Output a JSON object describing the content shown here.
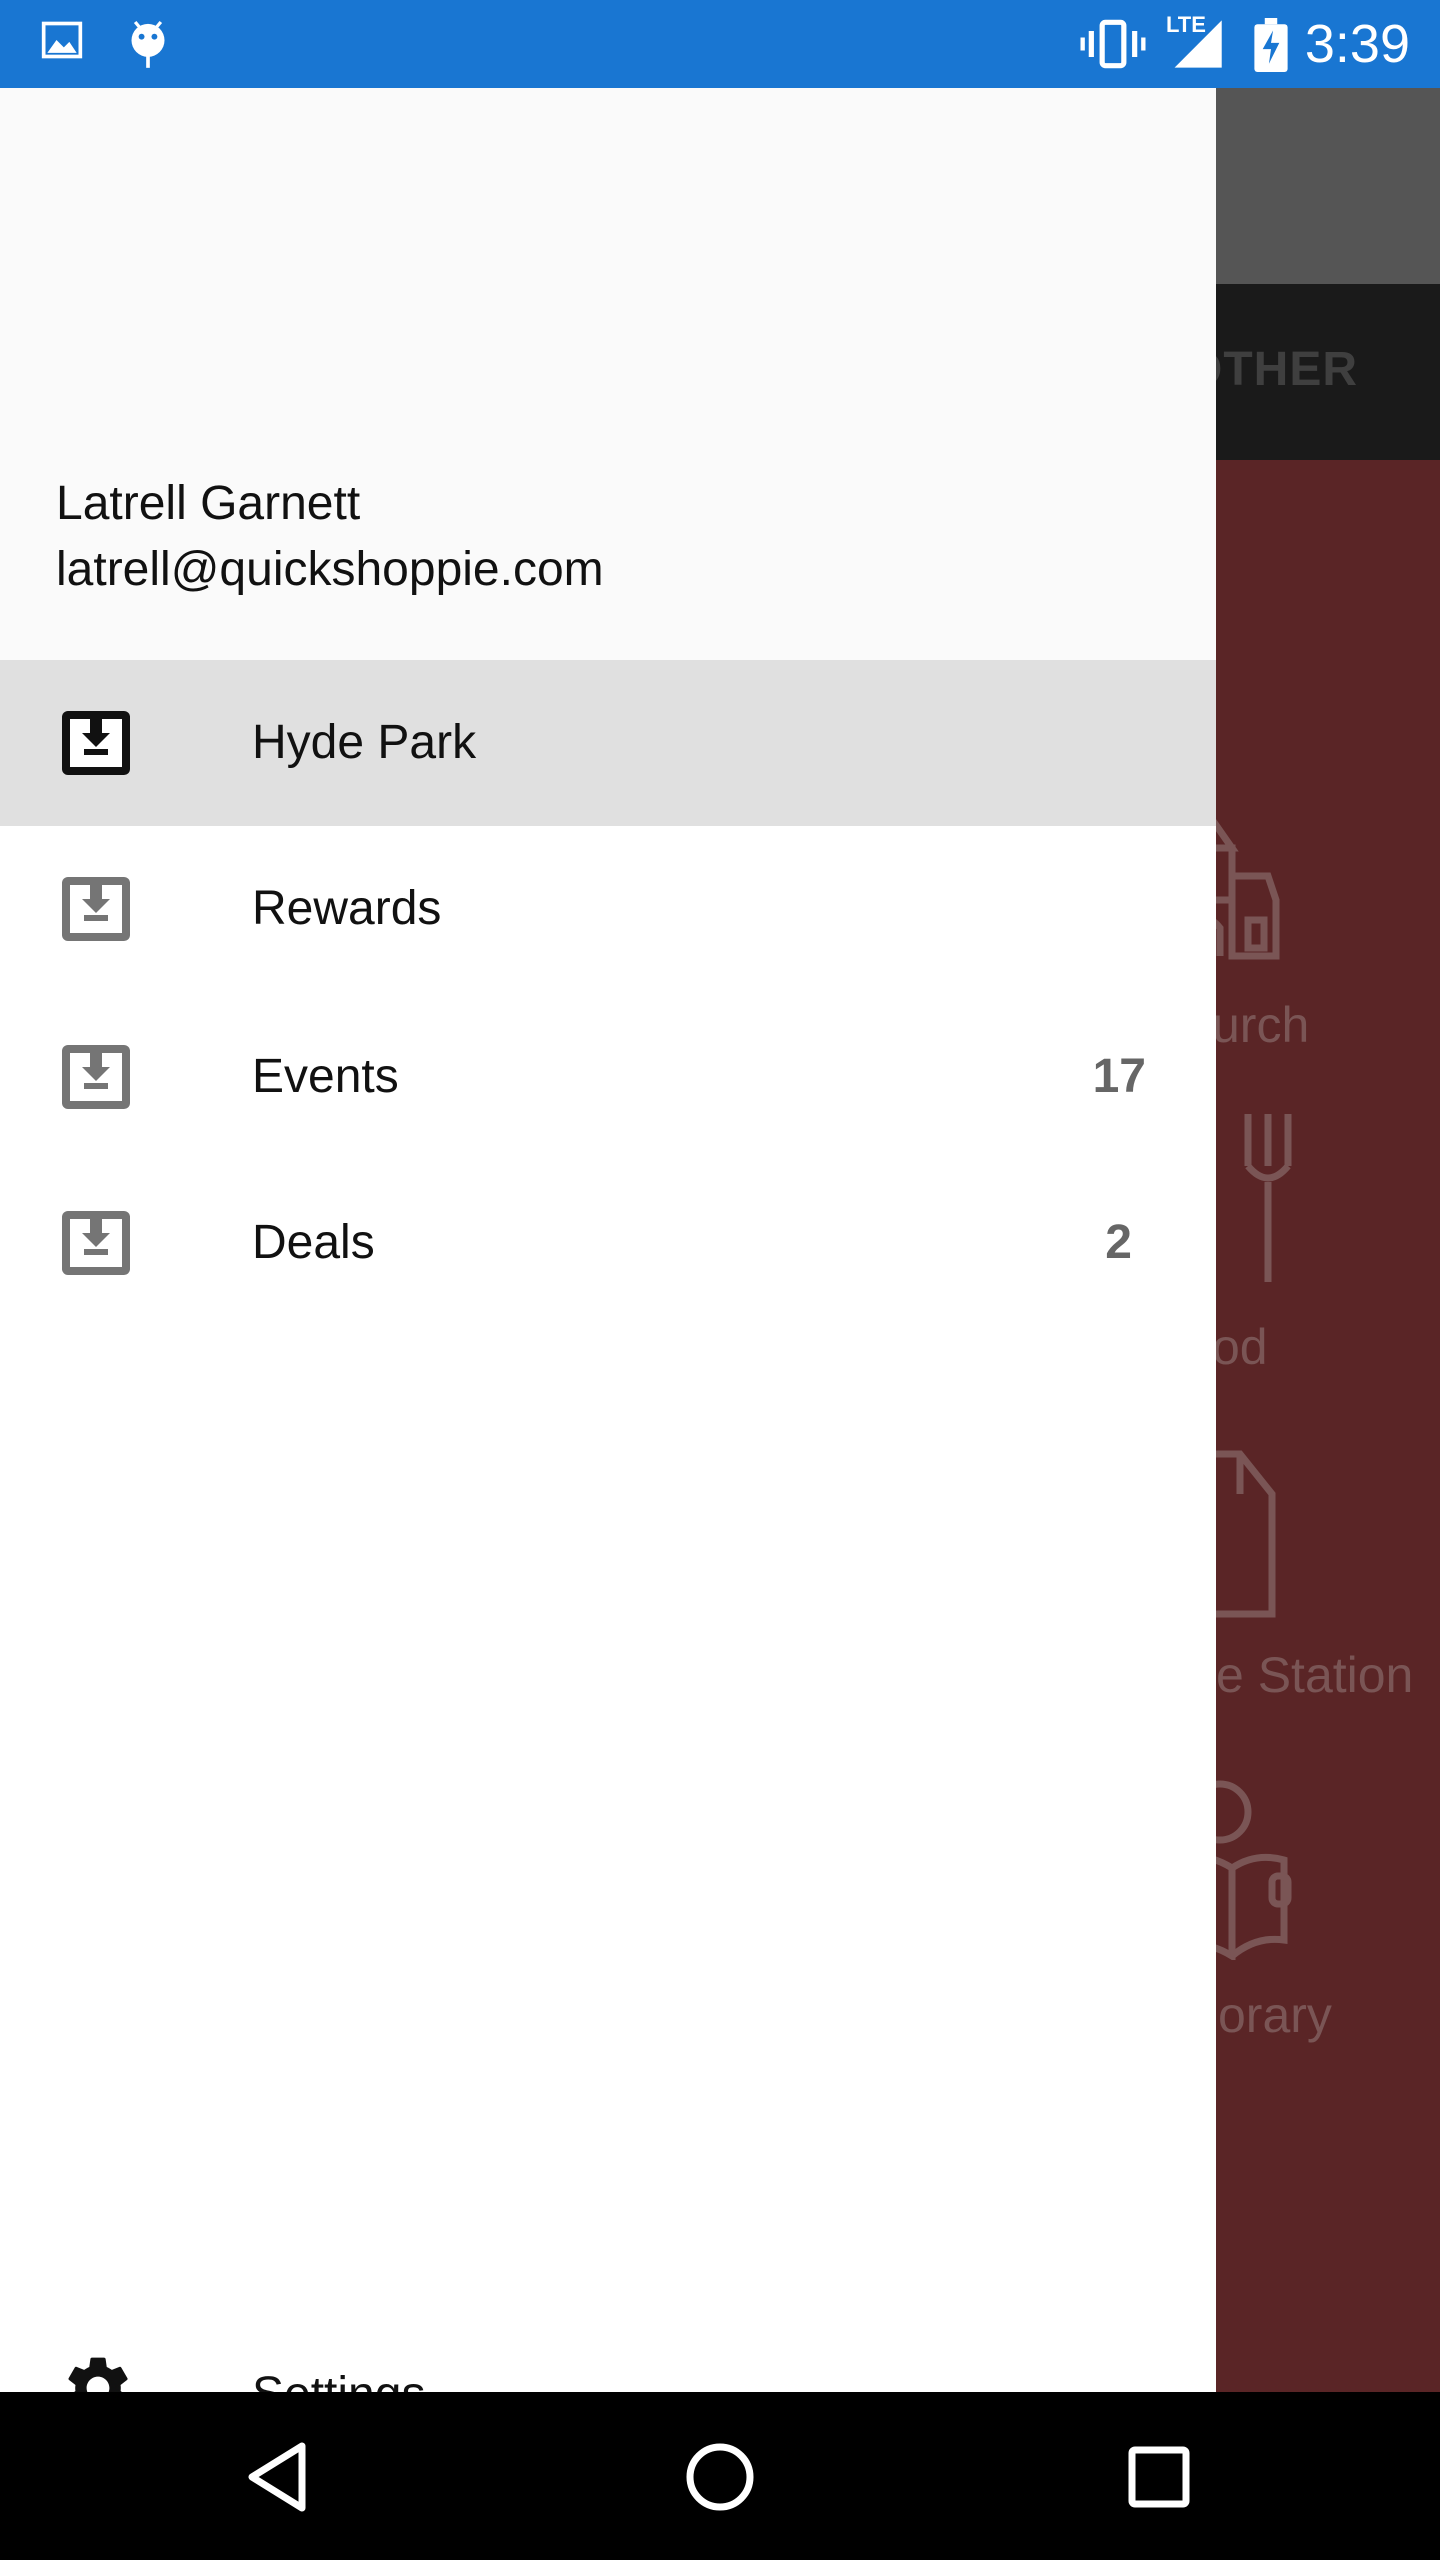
{
  "status_bar": {
    "time": "3:39",
    "left_icons": [
      "image-icon",
      "android-debug-icon"
    ],
    "right_icons": [
      "vibrate-icon",
      "lte-signal-icon",
      "battery-charging-icon"
    ],
    "network_label": "LTE"
  },
  "background_app": {
    "tab_label": "OTHER",
    "categories": [
      {
        "label": "Church",
        "icon": "church-icon"
      },
      {
        "label": "Food",
        "icon": "fork-knife-icon"
      },
      {
        "label": "Fire Station",
        "icon": "fire-station-icon"
      },
      {
        "label": "Library",
        "icon": "library-icon"
      }
    ],
    "visible_category_labels": [
      "urch",
      "od",
      "e Station",
      "orary"
    ]
  },
  "drawer": {
    "header": {
      "name": "Latrell Garnett",
      "email": "latrell@quickshoppie.com"
    },
    "items": [
      {
        "label": "Hyde Park",
        "count": "",
        "icon": "inbox-download-icon",
        "selected": true
      },
      {
        "label": "Rewards",
        "count": "",
        "icon": "inbox-download-icon",
        "selected": false
      },
      {
        "label": "Events",
        "count": "17",
        "icon": "inbox-download-icon",
        "selected": false
      },
      {
        "label": "Deals",
        "count": "2",
        "icon": "inbox-download-icon",
        "selected": false
      }
    ],
    "settings": {
      "label": "Settings",
      "icon": "gear-icon"
    }
  },
  "colors": {
    "status_bar": "#1976d2",
    "drawer_header": "#fafafa",
    "selected_item": "#e0e0e0",
    "background_content": "#5a2526"
  }
}
